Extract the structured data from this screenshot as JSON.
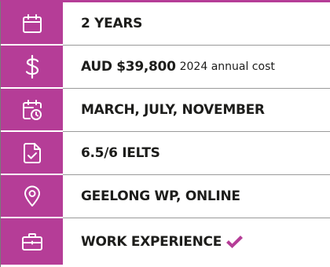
{
  "colors": {
    "accent": "#b53d97",
    "text": "#1d1d1b",
    "divider": "#9a9a9a"
  },
  "rows": [
    {
      "icon": "calendar-icon",
      "label": "2 YEARS"
    },
    {
      "icon": "dollar-icon",
      "label": "AUD $39,800",
      "note": "2024 annual cost"
    },
    {
      "icon": "calendar-clock-icon",
      "label": "MARCH, JULY, NOVEMBER"
    },
    {
      "icon": "document-check-icon",
      "label": "6.5/6 IELTS"
    },
    {
      "icon": "location-pin-icon",
      "label": "GEELONG WP, ONLINE"
    },
    {
      "icon": "briefcase-icon",
      "label": "WORK EXPERIENCE",
      "extra_icon": "checkmark-icon"
    }
  ]
}
